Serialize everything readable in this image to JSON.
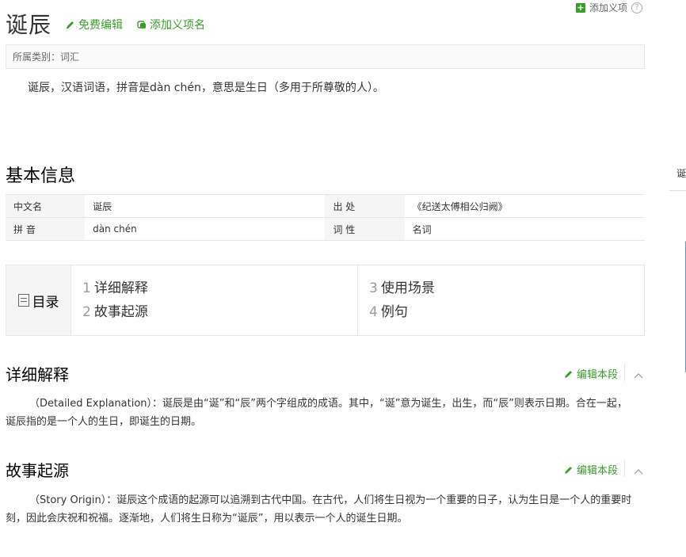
{
  "header": {
    "add_sense_label": "添加义项",
    "title": "诞辰",
    "edit_label": "免费编辑",
    "add_item_label": "添加义项名"
  },
  "category": {
    "label": "所属类别：",
    "value": "词汇"
  },
  "summary": "诞辰，汉语词语，拼音是dàn chén，意思是生日（多用于所尊敬的人）。",
  "basic_info": {
    "title": "基本信息",
    "rows": [
      {
        "k1": "中文名",
        "v1": "诞辰",
        "k2": "出 处",
        "v2": "《纪送太傅相公归阙》"
      },
      {
        "k1": "拼 音",
        "v1": "dàn chén",
        "k2": "词 性",
        "v2": "名词"
      }
    ]
  },
  "toc": {
    "title": "目录",
    "items": [
      {
        "num": "1",
        "label": "详细解释"
      },
      {
        "num": "2",
        "label": "故事起源"
      },
      {
        "num": "3",
        "label": "使用场景"
      },
      {
        "num": "4",
        "label": "例句"
      }
    ]
  },
  "sections": [
    {
      "title": "详细解释",
      "edit_label": "编辑本段",
      "text": "（Detailed Explanation）：诞辰是由“诞”和“辰”两个字组成的成语。其中，“诞”意为诞生，出生，而“辰”则表示日期。合在一起，诞辰指的是一个人的生日，即诞生的日期。"
    },
    {
      "title": "故事起源",
      "edit_label": "编辑本段",
      "text": "（Story Origin）：诞辰这个成语的起源可以追溯到古代中国。在古代，人们将生日视为一个重要的日子，认为生日是一个人的重要时刻，因此会庆祝和祝福。逐渐地，人们将生日称为“诞辰”，用以表示一个人的诞生日期。"
    }
  ],
  "sidebar": {
    "partial_char": "诞"
  },
  "colors": {
    "accent": "#3c9a2e",
    "border": "#e6e6e6"
  }
}
